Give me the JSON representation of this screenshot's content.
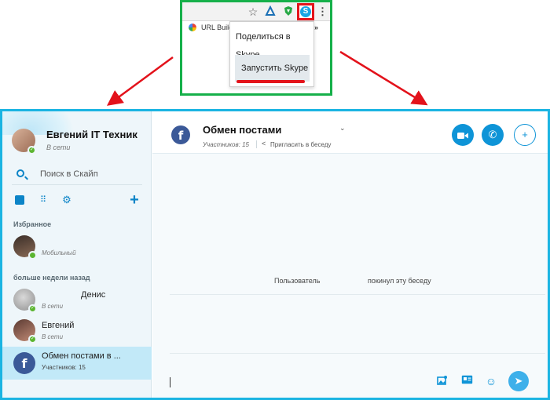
{
  "browser": {
    "extensions": {
      "star_icon": "☆",
      "triangle_icon": "▵",
      "shield_icon": "🛡",
      "skype_icon": "S",
      "menu_icon": "⋮"
    },
    "bookmark": {
      "label": "URL Build",
      "more": "»"
    },
    "popup": {
      "share_label": "Поделиться в Skype",
      "launch_label": "Запустить Skype"
    }
  },
  "skype": {
    "profile": {
      "name": "Евгений IT Техник",
      "status": "В сети"
    },
    "search": {
      "placeholder": "Поиск в Скайп"
    },
    "toolbar": {
      "contacts_icon": "",
      "dialpad_icon": "⠿",
      "settings_icon": "⚙",
      "add_icon": "+"
    },
    "sections": {
      "favorites": "Избранное",
      "older": "больше недели назад"
    },
    "favorites": [
      {
        "name": "",
        "status": "Мобильный"
      }
    ],
    "older_contacts": [
      {
        "name": "Денис",
        "status": "В сети"
      },
      {
        "name": "Евгений",
        "status": "В сети"
      },
      {
        "name": "Обмен постами в ...",
        "status": "Участников: 15"
      }
    ],
    "chat": {
      "avatar_letter": "f",
      "title": "Обмен постами",
      "chevron": "⌄",
      "members": "Участников: 15",
      "share_icon": "<",
      "invite": "Пригласить в беседу",
      "buttons": {
        "video_icon": "▶",
        "call_icon": "✆",
        "add_people_icon": "+"
      },
      "system_message": {
        "user": "Пользователь",
        "text": "покинул эту беседу"
      },
      "composer": {
        "image_icon": "▣",
        "card_icon": "▤",
        "emoji_icon": "☺",
        "send_icon": "➤"
      }
    }
  }
}
